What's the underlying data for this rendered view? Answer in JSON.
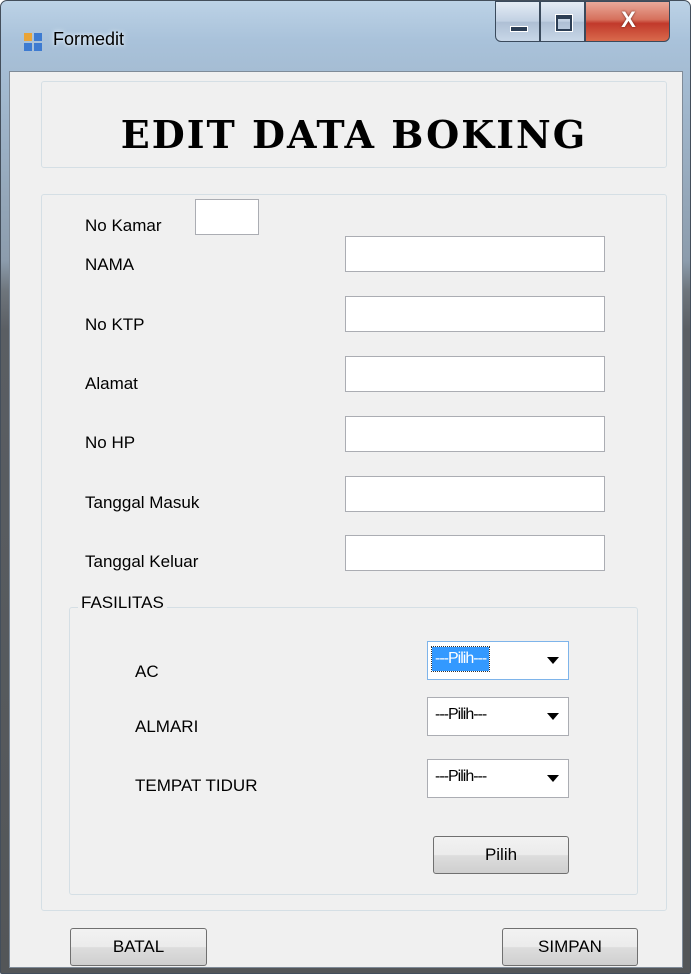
{
  "window": {
    "title": "Formedit",
    "close_glyph": "X"
  },
  "header": {
    "title": "EDIT DATA BOKING"
  },
  "form": {
    "no_kamar_label": "No Kamar",
    "nama_label": "NAMA",
    "no_ktp_label": "No KTP",
    "alamat_label": "Alamat",
    "no_hp_label": "No HP",
    "tanggal_masuk_label": "Tanggal Masuk",
    "tanggal_keluar_label": "Tanggal Keluar",
    "no_kamar_value": "",
    "nama_value": "",
    "no_ktp_value": "",
    "alamat_value": "",
    "no_hp_value": "",
    "tanggal_masuk_value": "",
    "tanggal_keluar_value": ""
  },
  "fasilitas": {
    "group_title": "FASILITAS",
    "ac_label": "AC",
    "almari_label": "ALMARI",
    "tempat_tidur_label": "TEMPAT TIDUR",
    "ac_value": "---Pilih---",
    "almari_value": "---Pilih---",
    "tempat_tidur_value": "---Pilih---",
    "pilih_button": "Pilih"
  },
  "buttons": {
    "batal": "BATAL",
    "simpan": "SIMPAN"
  },
  "colors": {
    "selection": "#3399ff",
    "close_button": "#c1392b",
    "dialog_bg": "#f0f0f0"
  },
  "icons": {
    "app": "windows-form-icon",
    "minimize": "minimize-icon",
    "maximize": "maximize-icon",
    "close": "close-icon",
    "dropdown": "chevron-down-icon"
  }
}
